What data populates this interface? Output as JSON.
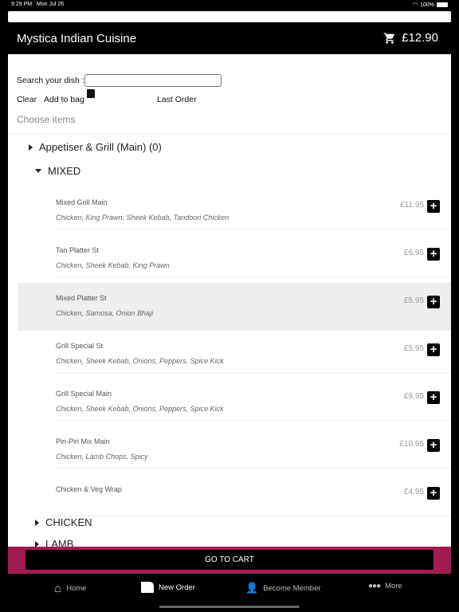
{
  "status": {
    "time": "9:29 PM",
    "date": "Mon Jul 26",
    "battery": "100%"
  },
  "header": {
    "title": "Mystica Indian Cuisine",
    "cart_total": "£12.90"
  },
  "search": {
    "label": "Search your dish :",
    "value": "",
    "placeholder": ""
  },
  "actions": {
    "clear": "Clear",
    "add_to_bag": "Add to bag",
    "last_order": "Last Order"
  },
  "choose_items": "Choose items",
  "categories": [
    {
      "label": "Appetiser & Grill (Main) (0)",
      "expanded": false
    },
    {
      "label": "MIXED",
      "expanded": true
    },
    {
      "label": "CHICKEN",
      "expanded": false
    },
    {
      "label": "LAMB",
      "expanded": false
    }
  ],
  "items": [
    {
      "name": "Mixed Grill Main",
      "desc": "Chicken, King Prawn, Sheek Kebab, Tandoori Chicken",
      "price": "£11.95"
    },
    {
      "name": "Tan Platter St",
      "desc": "Chicken, Sheek Kebab, King Prawn",
      "price": "£6.95"
    },
    {
      "name": "Mixed Platter St",
      "desc": "Chicken, Samosa, Onion Bhaji",
      "price": "£5.95",
      "highlighted": true
    },
    {
      "name": "Grill Special St",
      "desc": "Chicken, Sheek Kebab, Onions, Peppers, Spice Kick",
      "price": "£5.95"
    },
    {
      "name": "Grill Special Main",
      "desc": "Chicken, Sheek Kebab, Onions, Peppers, Spice Kick",
      "price": "£9.95"
    },
    {
      "name": "Piri-Piri Mix Main",
      "desc": "Chicken, Lamb Chops, Spicy",
      "price": "£10.95"
    },
    {
      "name": "Chicken & Veg Wrap",
      "desc": "",
      "price": "£4.95"
    }
  ],
  "go_to_cart": "GO TO CART",
  "tabs": [
    {
      "label": "Home",
      "icon": "home-icon"
    },
    {
      "label": "New Order",
      "icon": "new-order-icon",
      "active": true
    },
    {
      "label": "Become Member",
      "icon": "member-icon"
    },
    {
      "label": "More",
      "icon": "more-icon"
    }
  ],
  "colors": {
    "accent": "#a01c52"
  }
}
